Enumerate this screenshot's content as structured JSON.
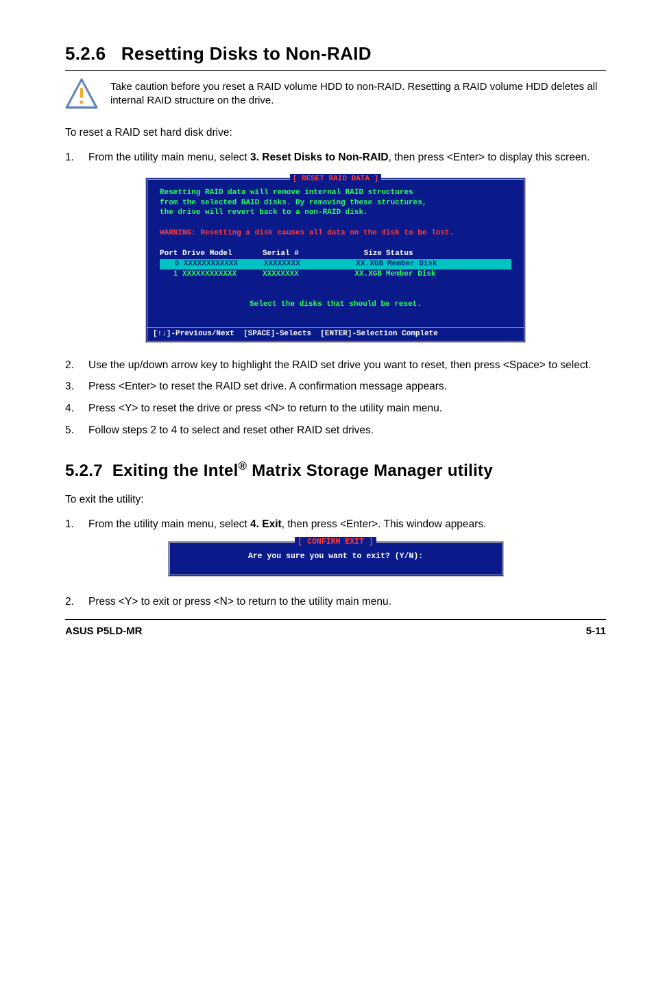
{
  "section1": {
    "number": "5.2.6",
    "title": "Resetting Disks to Non-RAID",
    "caution": "Take caution before you reset a RAID volume HDD to non-RAID. Resetting a RAID volume HDD deletes all internal RAID structure on the drive.",
    "intro": "To reset a RAID set hard disk drive:",
    "step1_pre": "From the utility main menu, select ",
    "step1_bold": "3. Reset Disks to Non-RAID",
    "step1_post": ", then press <Enter> to display this screen.",
    "step2": "Use the up/down arrow key to highlight the RAID set drive you want to reset, then press <Space> to select.",
    "step3": "Press <Enter> to reset the RAID set drive. A confirmation message appears.",
    "step4": "Press <Y> to reset the drive or press <N> to return to the utility main menu.",
    "step5": "Follow steps 2 to 4 to select and reset other RAID set drives."
  },
  "bios1": {
    "title": "[ RESET RAID DATA ]",
    "msg1": "Resetting RAID data will remove internal RAID structures",
    "msg2": "from the selected RAID disks. By removing these structures,",
    "msg3": "the drive will revert back to a non-RAID disk.",
    "warn": "WARNING: Resetting a disk causes all data on the disk to be lost.",
    "hdr_port": "Port Drive Model",
    "hdr_serial": "Serial #",
    "hdr_size": "Size",
    "hdr_status": "Status",
    "rows": [
      {
        "port": "   0 XXXXXXXXXXXX",
        "serial": "XXXXXXXX",
        "size": "XX.XGB",
        "status": "Member Disk"
      },
      {
        "port": "   1 XXXXXXXXXXXX",
        "serial": "XXXXXXXX",
        "size": "XX.XGB",
        "status": "Member Disk"
      }
    ],
    "select_msg": "Select the disks that should be reset.",
    "footer": "[↑↓]-Previous/Next  [SPACE]-Selects  [ENTER]-Selection Complete"
  },
  "section2": {
    "number": "5.2.7",
    "title_pre": "Exiting the Intel",
    "title_post": " Matrix Storage Manager utility",
    "intro": "To exit the utility:",
    "step1_pre": "From the utility main menu, select ",
    "step1_bold": "4. Exit",
    "step1_post": ", then press <Enter>. This window appears.",
    "step2": "Press <Y> to exit or press <N> to return to the utility main menu."
  },
  "bios2": {
    "title": "[ CONFIRM EXIT ]",
    "msg": "Are you sure you want to exit? (Y/N):"
  },
  "footer": {
    "left": "ASUS P5LD-MR",
    "right": "5-11"
  }
}
